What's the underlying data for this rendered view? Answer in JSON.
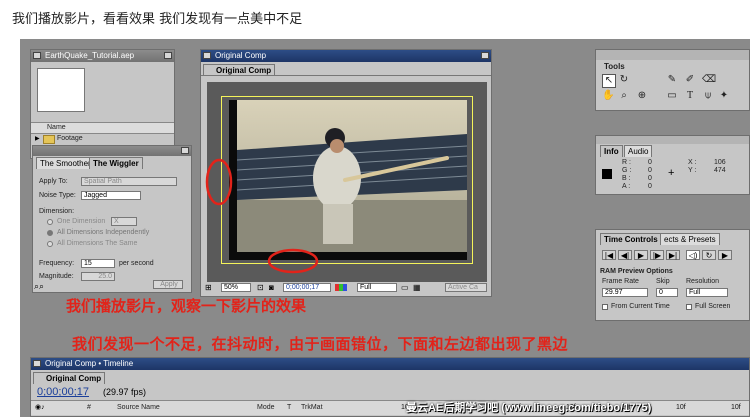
{
  "page": {
    "heading": "我们播放影片，看看效果 我们发现有一点美中不足"
  },
  "project": {
    "title": "EarthQuake_Tutorial.aep",
    "col_name": "Name",
    "folder": "Footage"
  },
  "effects": {
    "tab1": "The Smoother",
    "tab2": "The Wiggler",
    "apply_to_label": "Apply To:",
    "apply_to_value": "Spatial Path",
    "noise_label": "Noise Type:",
    "noise_value": "Jagged",
    "dimension_label": "Dimension:",
    "dim_one": "One Dimension",
    "dim_one_value": "X",
    "dim_all_indep": "All Dimensions Independently",
    "dim_all_same": "All Dimensions The Same",
    "frequency_label": "Frequency:",
    "frequency_value": "15",
    "per_second": "per second",
    "magnitude_label": "Magnitude:",
    "magnitude_value": "25.0",
    "apply": "Apply"
  },
  "comp": {
    "title": "Original Comp",
    "tab": "Original Comp",
    "zoom": "50%",
    "timecode": "0;00;00;17",
    "resolution": "Full",
    "active_camera": "Active Ca"
  },
  "tools": {
    "title": "Tools"
  },
  "info": {
    "tab1": "Info",
    "tab2": "Audio",
    "r": "R :",
    "g": "G :",
    "b": "B :",
    "a": "A :",
    "r_val": "0",
    "g_val": "0",
    "b_val": "0",
    "a_val": "0",
    "x": "X :",
    "y": "Y :",
    "x_val": "106",
    "y_val": "474"
  },
  "time_controls": {
    "tab1": "Time Controls",
    "tab2": "ects & Presets",
    "ram_title": "RAM Preview Options",
    "frame_rate_label": "Frame Rate",
    "frame_rate": "29.97",
    "skip_label": "Skip",
    "skip": "0",
    "resolution_label": "Resolution",
    "resolution": "Full",
    "from_current": "From Current Time",
    "full_screen": "Full Screen"
  },
  "annotations": {
    "line1": "我们播放影片，观察一下影片的效果",
    "line2": "我们发现一个不足，在抖动时，由于画面错位，下面和左边都出现了黑边"
  },
  "timeline": {
    "title": "Original Comp • Timeline",
    "tab": "Original Comp",
    "timecode": "0;00;00;17",
    "fps": "(29.97 fps)",
    "col_num": "#",
    "col_source": "Source Name",
    "col_mode": "Mode",
    "col_t": "T",
    "col_trkmat": "TrkMat",
    "ticks": [
      "10f",
      "10f",
      "10f",
      "10f",
      "10f",
      "10f",
      "10f"
    ]
  },
  "watermark": "曼云AE后期学习吧 (www.lineeg.com/tiebo/1775)",
  "colors": {
    "annotation_red": "#e2231a",
    "titlebar_active": "#2d4d86",
    "panel_bg": "#c6c6c6"
  }
}
